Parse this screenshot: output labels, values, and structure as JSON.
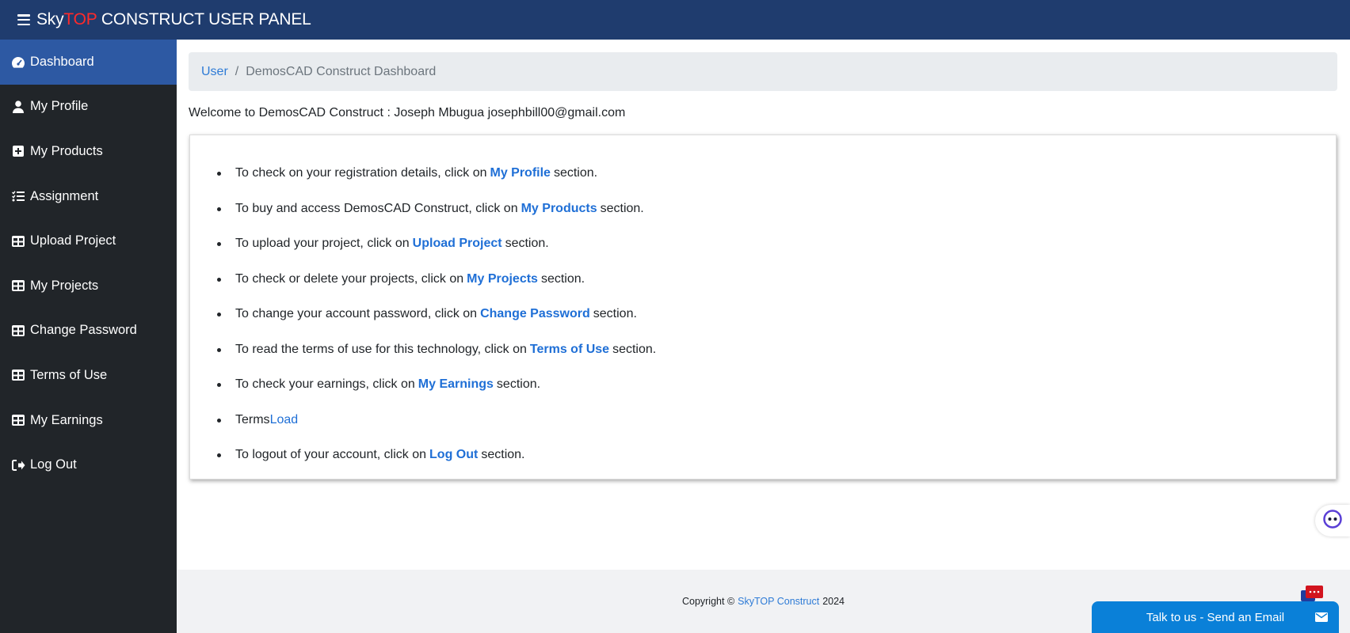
{
  "header": {
    "brand_prefix": "Sky",
    "brand_accent": "TOP",
    "brand_suffix": " CONSTRUCT USER PANEL"
  },
  "sidebar": {
    "items": [
      {
        "label": "Dashboard",
        "icon": "tachometer-icon",
        "active": true
      },
      {
        "label": "My Profile",
        "icon": "user-icon"
      },
      {
        "label": "My Products",
        "icon": "plus-square-icon"
      },
      {
        "label": "Assignment",
        "icon": "list-check-icon"
      },
      {
        "label": "Upload Project",
        "icon": "table-icon"
      },
      {
        "label": "My Projects",
        "icon": "table-icon"
      },
      {
        "label": "Change Password",
        "icon": "table-icon"
      },
      {
        "label": "Terms of Use",
        "icon": "table-icon"
      },
      {
        "label": "My Earnings",
        "icon": "table-icon"
      },
      {
        "label": "Log Out",
        "icon": "sign-out-icon"
      }
    ]
  },
  "breadcrumb": {
    "link": "User",
    "separator": "/",
    "current": "DemosCAD Construct Dashboard"
  },
  "welcome": "Welcome to DemosCAD Construct : Joseph Mbugua josephbill00@gmail.com",
  "instructions": [
    {
      "pre": "To check on your registration details, click on",
      "link": "My Profile",
      "post": "section."
    },
    {
      "pre": "To buy and access DemosCAD Construct, click on",
      "link": "My Products",
      "post": "section."
    },
    {
      "pre": "To upload your project, click on",
      "link": "Upload Project",
      "post": "section."
    },
    {
      "pre": "To check or delete your projects, click on",
      "link": "My Projects",
      "post": "section."
    },
    {
      "pre": "To change your account password, click on",
      "link": "Change Password",
      "post": "section."
    },
    {
      "pre": "To read the terms of use for this technology, click on",
      "link": "Terms of Use",
      "post": "section."
    },
    {
      "pre": "To check your earnings, click on",
      "link": "My Earnings",
      "post": "section."
    },
    {
      "pre": "Terms",
      "link": "Load",
      "post": ""
    },
    {
      "pre": "To logout of your account, click on",
      "link": "Log Out",
      "post": "section."
    }
  ],
  "footer": {
    "prefix": "Copyright ©",
    "link": "SkyTOP Construct",
    "year": "2024"
  },
  "chat_widget": {
    "label": "Talk to us - Send an Email",
    "icon": "envelope-icon"
  },
  "colors": {
    "topbar": "#1f3c6e",
    "sidebar": "#212529",
    "active": "#2d59a3",
    "link": "#1f6fd6",
    "chat": "#0a80d8",
    "brand_accent": "#ff2a2a"
  }
}
